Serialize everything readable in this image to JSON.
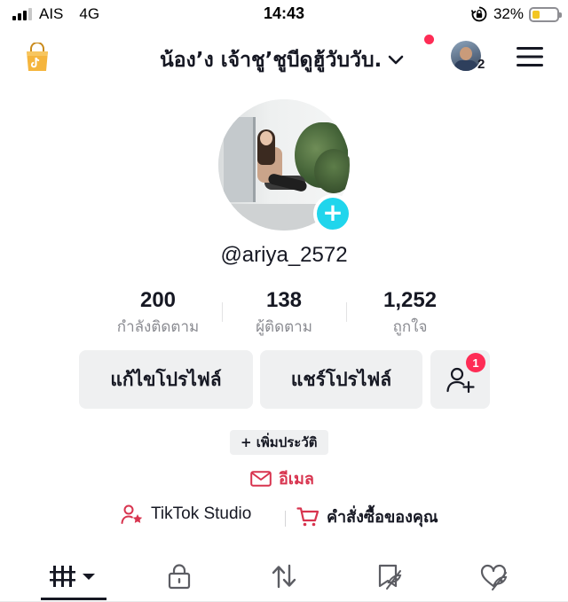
{
  "status_bar": {
    "carrier": "AIS",
    "network": "4G",
    "time": "14:43",
    "battery_percent": "32%",
    "battery_level": 0.32
  },
  "header": {
    "username": "น้อง’ง เจ้าชู’ชูบีดูฮู้วับวับ.",
    "notification_dot_color": "#fe2c55",
    "switch_account_count": "2"
  },
  "profile": {
    "handle": "@ariya_2572",
    "add_avatar_symbol": "+"
  },
  "stats": [
    {
      "value": "200",
      "label": "กำลังติดตาม"
    },
    {
      "value": "138",
      "label": "ผู้ติดตาม"
    },
    {
      "value": "1,252",
      "label": "ถูกใจ"
    }
  ],
  "actions": {
    "edit_profile": "แก้ไขโปรไฟล์",
    "share_profile": "แชร์โปรไฟล์",
    "friend_requests_badge": "1"
  },
  "bio": {
    "add_bio": "+ เพิ่มประวัติ",
    "email_label": "อีเมล"
  },
  "links": {
    "studio": "TikTok Studio",
    "orders": "คำสั่งซื้อของคุณ"
  },
  "tabs": [
    {
      "icon": "videos-grid-icon",
      "active": true
    },
    {
      "icon": "private-lock-icon",
      "active": false
    },
    {
      "icon": "reposts-icon",
      "active": false
    },
    {
      "icon": "favorites-icon",
      "active": false
    },
    {
      "icon": "liked-icon",
      "active": false
    }
  ],
  "colors": {
    "accent_red": "#fe2c55",
    "email_red": "#d8344f",
    "avatar_add": "#20d5ec",
    "text": "#161823",
    "muted": "#8a8b91",
    "button_bg": "#eff0f1"
  }
}
